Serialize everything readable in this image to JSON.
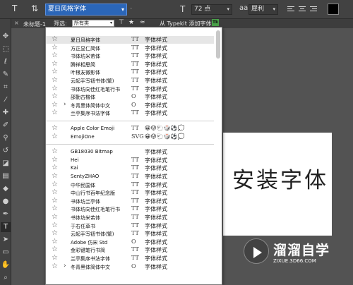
{
  "options_bar": {
    "font_family": "夏日风格字体",
    "font_style": "-",
    "font_size": "72 点",
    "anti_alias": "犀利",
    "text_color": "#000000"
  },
  "doc_tab": {
    "title": "未标题-1"
  },
  "filter": {
    "label": "筛选:",
    "value": "所有类",
    "typekit_label": "从 Typekit 添加字体:",
    "typekit_badge": "Tk"
  },
  "font_groups": [
    {
      "fonts": [
        {
          "name": "夏日风格字体",
          "type": "TT",
          "sample": "字体样式",
          "selected": true
        },
        {
          "name": "方正显仁简体",
          "type": "TT",
          "sample": "字体样式"
        },
        {
          "name": "书体坊米芾体",
          "type": "TT",
          "sample": "字体样式"
        },
        {
          "name": "腾祥相思简",
          "type": "TT",
          "sample": "字体样式"
        },
        {
          "name": "叶根友微影体",
          "type": "TT",
          "sample": "字体样式"
        },
        {
          "name": "云起手写钮书体(繁)",
          "type": "TT",
          "sample": "字体样式"
        },
        {
          "name": "书体坊向佳红毛笔行书",
          "type": "TT",
          "sample": "字体样式"
        },
        {
          "name": "邵勤古楷体",
          "type": "O",
          "sample": "字体样式"
        },
        {
          "name": "冬青黑体简体中文",
          "type": "O",
          "sample": "字体样式",
          "expandable": true
        },
        {
          "name": "兰亭集序书法字体",
          "type": "TT",
          "sample": "字体样式"
        }
      ]
    },
    {
      "fonts": [
        {
          "name": "Apple Color Emoji",
          "type": "TT",
          "sample": "😀😜🐑🎲⚽💭"
        },
        {
          "name": "EmojiOne",
          "type": "SVG",
          "sample": "😀😜🐑🎲⚽💭"
        }
      ]
    },
    {
      "fonts": [
        {
          "name": "GB18030 Bitmap",
          "type": "",
          "sample": "字体样式"
        },
        {
          "name": "Hei",
          "type": "TT",
          "sample": "字体样式"
        },
        {
          "name": "Kai",
          "type": "TT",
          "sample": "字体样式"
        },
        {
          "name": "SentyZHAO",
          "type": "TT",
          "sample": "字体样式"
        },
        {
          "name": "中华民国体",
          "type": "TT",
          "sample": "字体样式"
        },
        {
          "name": "中山行书百年纪念版",
          "type": "TT",
          "sample": "字体样式"
        },
        {
          "name": "书体坊兰亭体",
          "type": "TT",
          "sample": "字体样式"
        },
        {
          "name": "书体坊向佳红毛笔行书",
          "type": "TT",
          "sample": "字体样式"
        },
        {
          "name": "书体坊米芾体",
          "type": "TT",
          "sample": "字体样式"
        },
        {
          "name": "于右任草书",
          "type": "TT",
          "sample": "字体样式"
        },
        {
          "name": "云起手写钮书体(繁)",
          "type": "TT",
          "sample": "字体样式"
        },
        {
          "name": "Adobe 仿宋 Std",
          "type": "O",
          "sample": "字体样式"
        },
        {
          "name": "金彩键笔行书简",
          "type": "TT",
          "sample": "字体样式"
        },
        {
          "name": "兰亭集序书法字体",
          "type": "TT",
          "sample": "字体样式"
        },
        {
          "name": "冬青黑体简体中文",
          "type": "O",
          "sample": "字体样式",
          "expandable": true
        }
      ]
    }
  ],
  "canvas": {
    "text": "安装字体"
  },
  "watermark": {
    "title": "溜溜自学",
    "url": "ZIXUE.3D66.COM"
  }
}
